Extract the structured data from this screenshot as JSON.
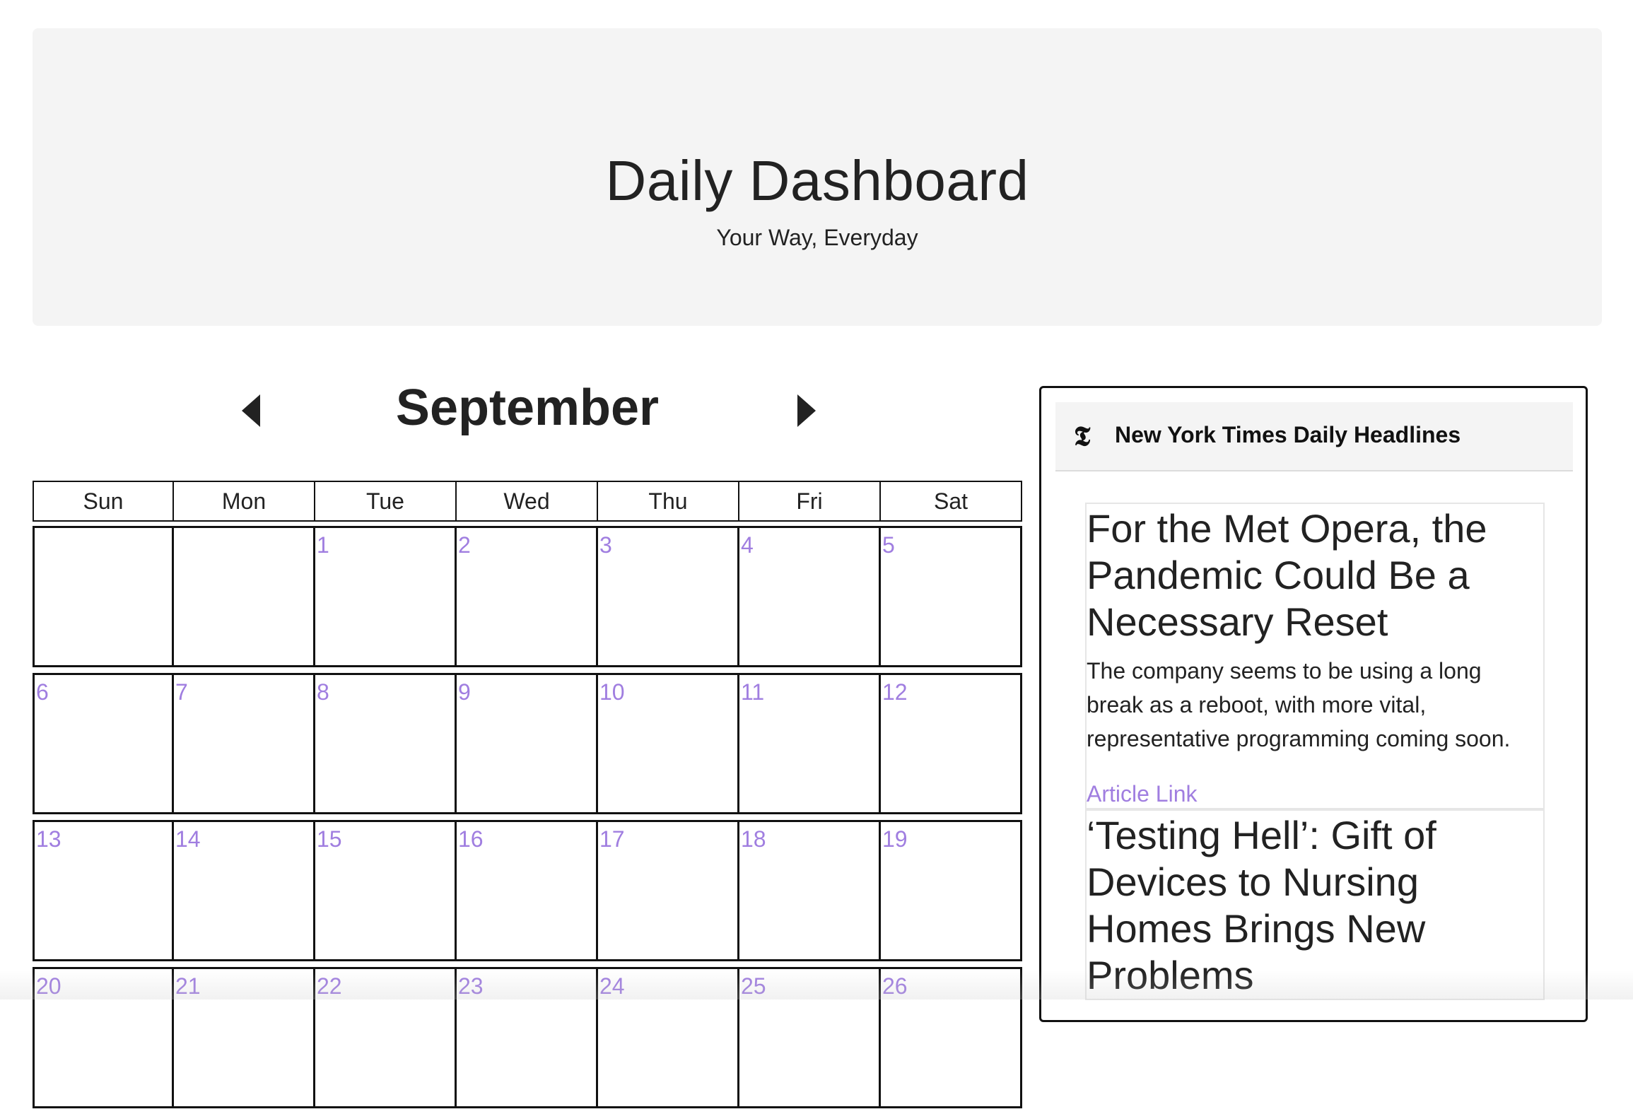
{
  "header": {
    "title": "Daily Dashboard",
    "subtitle": "Your Way, Everyday"
  },
  "calendar": {
    "month": "September",
    "prev_icon": "triangle-left-icon",
    "next_icon": "triangle-right-icon",
    "weekdays": [
      "Sun",
      "Mon",
      "Tue",
      "Wed",
      "Thu",
      "Fri",
      "Sat"
    ],
    "weeks": [
      [
        "",
        "",
        "1",
        "2",
        "3",
        "4",
        "5"
      ],
      [
        "6",
        "7",
        "8",
        "9",
        "10",
        "11",
        "12"
      ],
      [
        "13",
        "14",
        "15",
        "16",
        "17",
        "18",
        "19"
      ],
      [
        "20",
        "21",
        "22",
        "23",
        "24",
        "25",
        "26"
      ]
    ],
    "day_number_color": "#a07ee0"
  },
  "news": {
    "icon": "nyt-logo-icon",
    "title": "New York Times Daily Headlines",
    "articles": [
      {
        "headline": "For the Met Opera, the Pandemic Could Be a Necessary Reset",
        "summary": "The company seems to be using a long break as a reboot, with more vital, representative programming coming soon.",
        "link_label": "Article Link"
      },
      {
        "headline": "‘Testing Hell’: Gift of Devices to Nursing Homes Brings New Problems",
        "summary": "",
        "link_label": ""
      }
    ]
  },
  "colors": {
    "accent": "#a07ee0",
    "jumbotron_bg": "#f4f4f4",
    "text": "#222222"
  }
}
